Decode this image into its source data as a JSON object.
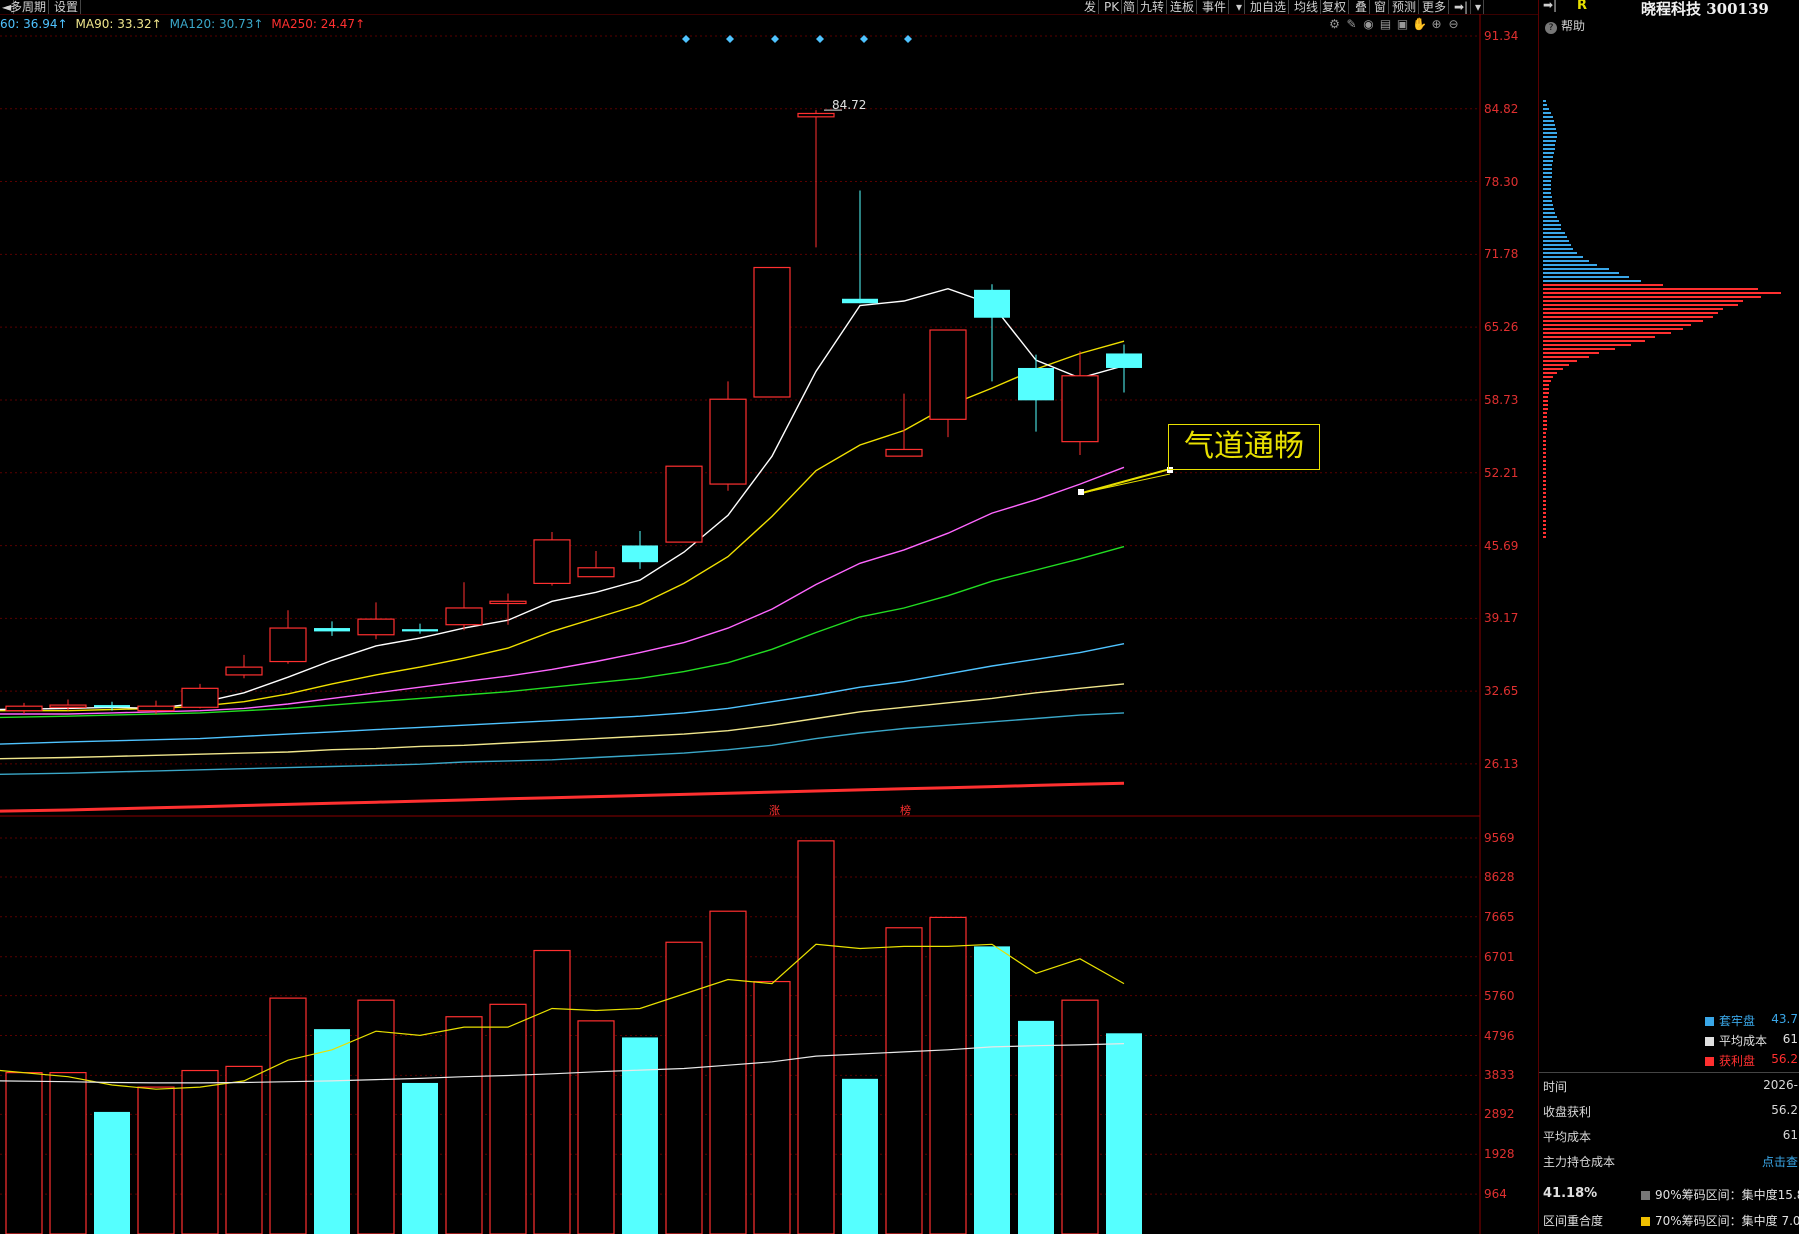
{
  "toolbar": {
    "left_items": [
      "◄",
      "多周期",
      "设置"
    ],
    "right_items": [
      "发",
      "PK",
      "简",
      "九转",
      "连板",
      "事件",
      "▾",
      "加自选",
      "均线",
      "复权",
      "叠",
      "窗",
      "预测",
      "更多",
      "➡|",
      "▾"
    ]
  },
  "ma_legend": [
    {
      "label": "60: 36.94↑",
      "color": "#4fc3ff"
    },
    {
      "label": "MA90: 33.32↑",
      "color": "#f0e68c"
    },
    {
      "label": "MA120: 30.73↑",
      "color": "#3aa7c8"
    },
    {
      "label": "MA250: 24.47↑",
      "color": "#ff3030"
    }
  ],
  "chart_icons": [
    "gear-icon",
    "pen-icon",
    "eye-icon",
    "printer-icon",
    "lock-icon",
    "hand-icon",
    "zoom-in-icon",
    "zoom-out-icon"
  ],
  "price_axis": [
    "91.34",
    "84.82",
    "78.30",
    "71.78",
    "65.26",
    "58.73",
    "52.21",
    "45.69",
    "39.17",
    "32.65",
    "26.13"
  ],
  "volume_axis": [
    "9569",
    "8628",
    "7665",
    "6701",
    "5760",
    "4796",
    "3833",
    "2892",
    "1928",
    "964"
  ],
  "high_marker": "84.72",
  "event_markers": [
    "涨",
    "榜"
  ],
  "annotation_text": "气道通畅",
  "colors": {
    "up": "#ff3030",
    "down": "#55ffff",
    "grid": "#5a0000",
    "ma5": "#ffffff",
    "ma10": "#f0e000",
    "ma20": "#ff66ff",
    "ma30": "#22dd22",
    "ma60": "#4fc3ff",
    "ma90": "#f0e68c",
    "ma120": "#3aa7c8",
    "ma250": "#ff3030",
    "annotation": "#e8e000"
  },
  "sidebar": {
    "arrow": "➡|",
    "badge": "R",
    "title": "晓程科技 300139",
    "help": "帮助",
    "legend": [
      {
        "label": "套牢盘",
        "value": "43.7",
        "color": "#3aa7e8"
      },
      {
        "label": "平均成本",
        "value": "61",
        "color": "#e0e0e0"
      },
      {
        "label": "获利盘",
        "value": "56.2",
        "color": "#ff3030"
      }
    ],
    "rows": [
      {
        "label": "时间",
        "value": "2026-"
      },
      {
        "label": "收盘获利",
        "value": "56.2"
      },
      {
        "label": "平均成本",
        "value": "61"
      },
      {
        "label": "主力持仓成本",
        "value": "点击查"
      }
    ],
    "footer": {
      "pct": "41.18%",
      "overlap_label": "区间重合度",
      "range90": "90%筹码区间：集中度15.8",
      "range70": "70%筹码区间：集中度 7.0"
    }
  },
  "chart_data": {
    "type": "candlestick",
    "price_ylim": [
      22.0,
      91.34
    ],
    "volume_ylim": [
      0,
      9569
    ],
    "candles": [
      {
        "o": 30.9,
        "c": 31.3,
        "h": 31.6,
        "l": 30.6,
        "v": 3900
      },
      {
        "o": 31.2,
        "c": 31.4,
        "h": 31.9,
        "l": 30.9,
        "v": 3900
      },
      {
        "o": 31.4,
        "c": 31.2,
        "h": 31.7,
        "l": 30.9,
        "v": 2950
      },
      {
        "o": 30.9,
        "c": 31.3,
        "h": 31.8,
        "l": 30.6,
        "v": 3550
      },
      {
        "o": 31.2,
        "c": 32.9,
        "h": 33.3,
        "l": 31.1,
        "v": 3950
      },
      {
        "o": 34.1,
        "c": 34.8,
        "h": 35.9,
        "l": 33.8,
        "v": 4050
      },
      {
        "o": 35.3,
        "c": 38.3,
        "h": 39.9,
        "l": 35.1,
        "v": 5700
      },
      {
        "o": 38.3,
        "c": 38.0,
        "h": 38.9,
        "l": 37.6,
        "v": 4950
      },
      {
        "o": 37.7,
        "c": 39.1,
        "h": 40.6,
        "l": 37.3,
        "v": 5650
      },
      {
        "o": 38.2,
        "c": 38.0,
        "h": 38.7,
        "l": 37.8,
        "v": 3650
      },
      {
        "o": 38.6,
        "c": 40.1,
        "h": 42.4,
        "l": 38.1,
        "v": 5250
      },
      {
        "o": 40.5,
        "c": 40.7,
        "h": 41.4,
        "l": 38.6,
        "v": 5550
      },
      {
        "o": 42.3,
        "c": 46.2,
        "h": 46.9,
        "l": 42.1,
        "v": 6850
      },
      {
        "o": 42.9,
        "c": 43.7,
        "h": 45.2,
        "l": 42.9,
        "v": 5150
      },
      {
        "o": 45.7,
        "c": 44.2,
        "h": 47.0,
        "l": 43.6,
        "v": 4750
      },
      {
        "o": 46.0,
        "c": 52.8,
        "h": 52.8,
        "l": 46.0,
        "v": 7050
      },
      {
        "o": 51.2,
        "c": 58.8,
        "h": 60.4,
        "l": 50.6,
        "v": 7800
      },
      {
        "o": 59.0,
        "c": 70.6,
        "h": 70.6,
        "l": 59.0,
        "v": 6100
      },
      {
        "o": 84.1,
        "c": 84.4,
        "h": 84.7,
        "l": 72.4,
        "v": 9500
      },
      {
        "o": 67.8,
        "c": 67.4,
        "h": 77.5,
        "l": 67.4,
        "v": 3750
      },
      {
        "o": 53.7,
        "c": 54.3,
        "h": 59.3,
        "l": 53.7,
        "v": 7400
      },
      {
        "o": 57.0,
        "c": 65.0,
        "h": 65.0,
        "l": 55.4,
        "v": 7650
      },
      {
        "o": 68.6,
        "c": 66.1,
        "h": 69.1,
        "l": 60.4,
        "v": 6950
      },
      {
        "o": 61.6,
        "c": 58.7,
        "h": 62.8,
        "l": 55.9,
        "v": 5150
      },
      {
        "o": 55.0,
        "c": 60.9,
        "h": 63.1,
        "l": 53.8,
        "v": 5650
      },
      {
        "o": 62.9,
        "c": 61.6,
        "h": 63.7,
        "l": 59.4,
        "v": 4850
      }
    ],
    "ma5": [
      31.0,
      31.1,
      31.2,
      31.1,
      31.6,
      32.5,
      33.9,
      35.4,
      36.7,
      37.4,
      38.3,
      39.0,
      40.7,
      41.5,
      42.6,
      45.1,
      48.4,
      53.7,
      61.3,
      67.2,
      67.6,
      68.7,
      67.3,
      62.3,
      60.7,
      61.8
    ],
    "ma10": [
      30.9,
      30.9,
      31.0,
      31.1,
      31.3,
      31.7,
      32.4,
      33.3,
      34.1,
      34.8,
      35.6,
      36.5,
      38.0,
      39.2,
      40.4,
      42.3,
      44.7,
      48.3,
      52.4,
      54.7,
      56.0,
      58.2,
      59.8,
      61.5,
      62.9,
      64.0
    ],
    "ma20": [
      30.6,
      30.6,
      30.7,
      30.8,
      30.9,
      31.1,
      31.5,
      32.0,
      32.5,
      33.0,
      33.5,
      34.0,
      34.6,
      35.3,
      36.1,
      37.0,
      38.3,
      40.0,
      42.2,
      44.1,
      45.3,
      46.8,
      48.6,
      49.8,
      51.2,
      52.7
    ],
    "ma30": [
      30.3,
      30.4,
      30.5,
      30.6,
      30.7,
      30.9,
      31.1,
      31.4,
      31.7,
      32.0,
      32.3,
      32.6,
      33.0,
      33.4,
      33.8,
      34.4,
      35.2,
      36.4,
      37.9,
      39.3,
      40.1,
      41.2,
      42.5,
      43.5,
      44.5,
      45.6
    ],
    "ma60": [
      27.9,
      28.1,
      28.2,
      28.3,
      28.4,
      28.6,
      28.8,
      29.0,
      29.2,
      29.4,
      29.6,
      29.8,
      30.0,
      30.2,
      30.4,
      30.7,
      31.1,
      31.7,
      32.3,
      33.0,
      33.5,
      34.2,
      34.9,
      35.5,
      36.1,
      36.9
    ],
    "ma90": [
      26.6,
      26.7,
      26.8,
      26.9,
      27.0,
      27.1,
      27.2,
      27.4,
      27.5,
      27.7,
      27.8,
      28.0,
      28.2,
      28.4,
      28.6,
      28.8,
      29.1,
      29.6,
      30.2,
      30.8,
      31.2,
      31.6,
      32.0,
      32.5,
      32.9,
      33.3
    ],
    "ma120": [
      25.2,
      25.3,
      25.4,
      25.5,
      25.6,
      25.7,
      25.8,
      25.9,
      26.0,
      26.1,
      26.3,
      26.4,
      26.5,
      26.7,
      26.9,
      27.1,
      27.4,
      27.8,
      28.4,
      28.9,
      29.3,
      29.6,
      29.9,
      30.2,
      30.5,
      30.7
    ],
    "ma250": [
      21.9,
      22.0,
      22.1,
      22.2,
      22.3,
      22.4,
      22.5,
      22.6,
      22.7,
      22.8,
      22.9,
      23.0,
      23.1,
      23.2,
      23.3,
      23.4,
      23.5,
      23.6,
      23.7,
      23.8,
      23.9,
      24.0,
      24.1,
      24.2,
      24.3,
      24.4
    ],
    "vol_ma5": [
      3950,
      3800,
      3600,
      3500,
      3550,
      3700,
      4200,
      4450,
      4900,
      4800,
      5000,
      5000,
      5450,
      5400,
      5450,
      5800,
      6150,
      6050,
      7000,
      6900,
      6950,
      6950,
      7000,
      6300,
      6650,
      6050
    ],
    "vol_ma10": [
      3700,
      3680,
      3660,
      3650,
      3650,
      3660,
      3680,
      3700,
      3730,
      3760,
      3800,
      3830,
      3870,
      3920,
      3960,
      4000,
      4080,
      4160,
      4300,
      4350,
      4400,
      4450,
      4520,
      4550,
      4570,
      4600
    ],
    "chip_distribution": {
      "price_levels_top": [
        84,
        80,
        76,
        72,
        70,
        68,
        67,
        66,
        65,
        64,
        63,
        62.5,
        62,
        61.5,
        61,
        60.5,
        60,
        59.5,
        59,
        58.5,
        58,
        57.5,
        57,
        56.5,
        56,
        55.5,
        55,
        54.5,
        54,
        53,
        50,
        47,
        44,
        41
      ]
    }
  }
}
